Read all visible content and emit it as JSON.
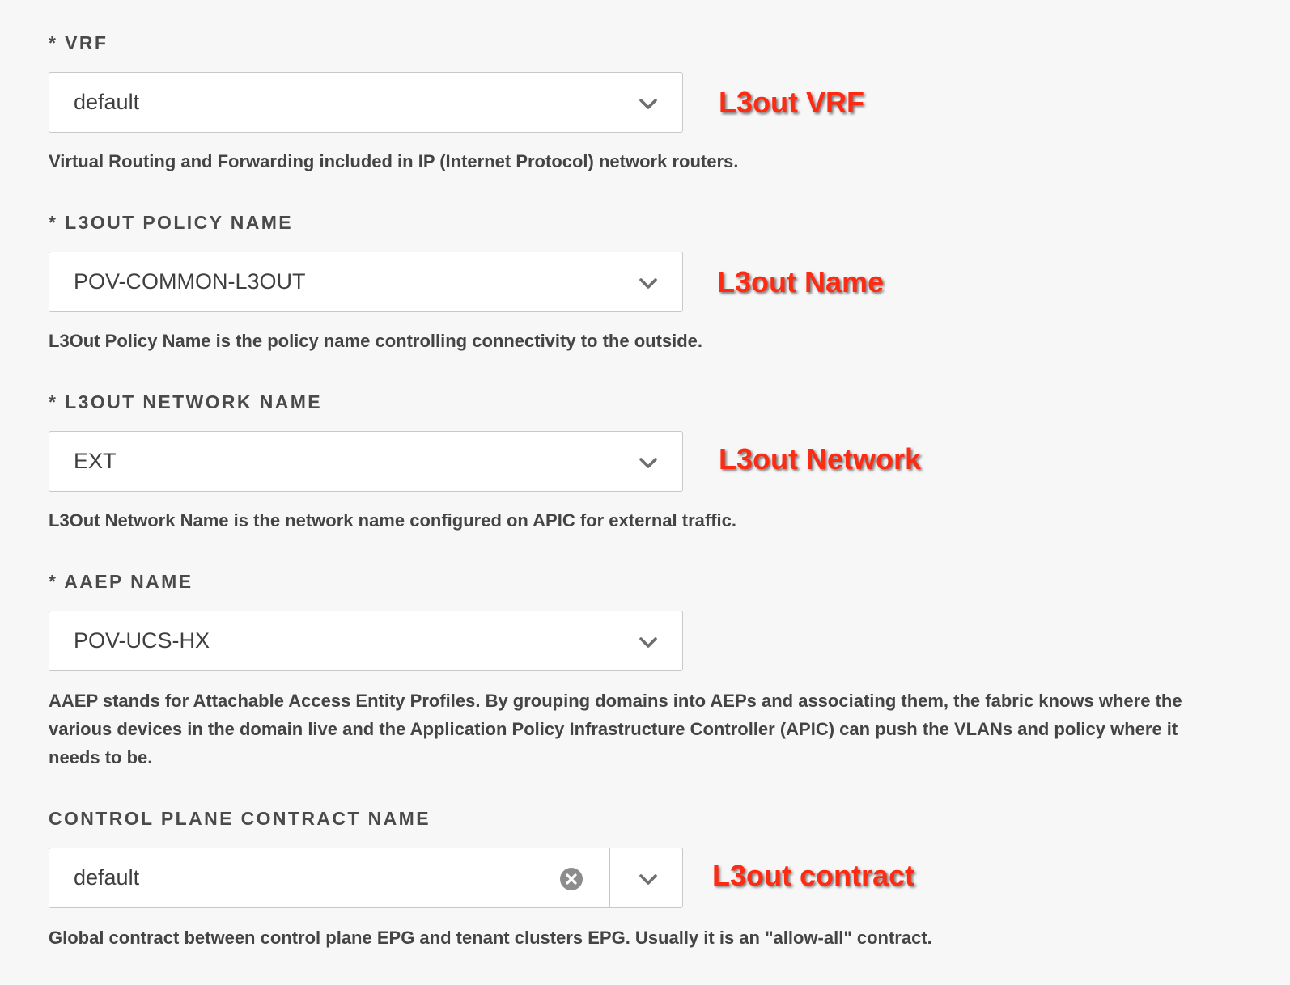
{
  "fields": [
    {
      "label": "* VRF",
      "value": "default",
      "help": "Virtual Routing and Forwarding included in IP (Internet Protocol) network routers.",
      "annotation": "L3out VRF"
    },
    {
      "label": "* L3OUT POLICY NAME",
      "value": "POV-COMMON-L3OUT",
      "help": "L3Out Policy Name is the policy name controlling connectivity to the outside.",
      "annotation": "L3out Name"
    },
    {
      "label": "* L3OUT NETWORK NAME",
      "value": "EXT",
      "help": "L3Out Network Name is the network name configured on APIC for external traffic.",
      "annotation": "L3out Network"
    },
    {
      "label": "* AAEP NAME",
      "value": "POV-UCS-HX",
      "help": "AAEP stands for Attachable Access Entity Profiles. By grouping domains into AEPs and associating them, the fabric knows where the various devices in the domain live and the Application Policy Infrastructure Controller (APIC) can push the VLANs and policy where it needs to be.",
      "annotation": ""
    },
    {
      "label": "CONTROL PLANE CONTRACT NAME",
      "value": "default",
      "help": "Global contract between control plane EPG and tenant clusters EPG. Usually it is an \"allow-all\" contract.",
      "annotation": "L3out contract"
    }
  ],
  "icons": {
    "dropdown": "chevron-down-icon",
    "clear": "clear-circle-x-icon"
  },
  "colors": {
    "background": "#f7f7f7",
    "annotation": "#ff2a12",
    "label": "#4a4a4a",
    "border": "#c8c8c8"
  }
}
